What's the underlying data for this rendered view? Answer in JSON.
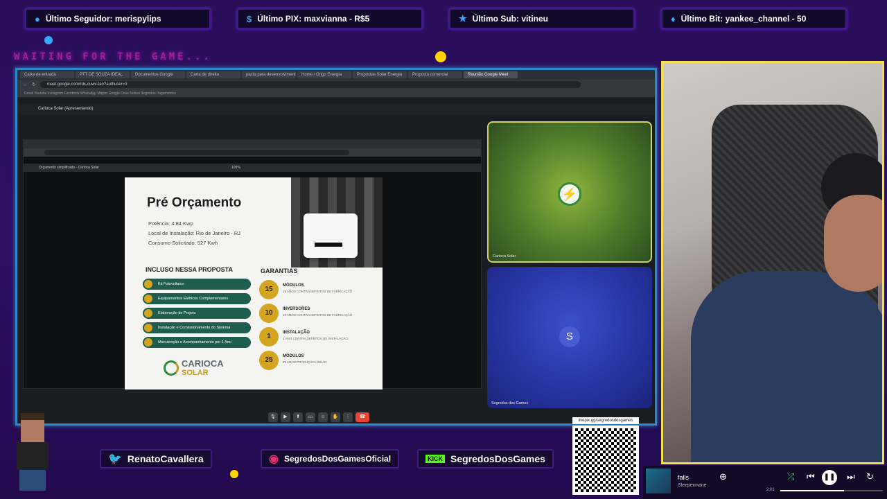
{
  "overlay": {
    "tickers": [
      {
        "label": "Último Seguidor: merispylips",
        "icon": "user-icon"
      },
      {
        "label": "Último PIX: maxvianna - R$5",
        "icon": "dollar-icon"
      },
      {
        "label": "Último Sub: vitineu",
        "icon": "star-icon"
      },
      {
        "label": "Último Bit: yankee_channel - 50",
        "icon": "diamond-icon"
      }
    ],
    "waiting_text": "WAITING FOR THE GAME..."
  },
  "browser": {
    "url": "meet.google.com/rdx-cuwv-tao?authuser=0",
    "tabs": [
      "Caixa de entrada",
      "PTT DE SOUZA IDEAL",
      "Documentos Google",
      "Carta de direito",
      "pasta para desenvolvimento",
      "Home / Origo Energia",
      "Propostas Solar Energia",
      "Proposta comercial",
      "Reunião Google Meet"
    ],
    "bookmarks": "Gmail  Youtube  Instagram  Facebook  WhatsApp  Mapas  Google Drive  Notion  Segredos  Pagamentos"
  },
  "meet": {
    "title": "Carioca Solar (Apresentando)",
    "participants": [
      {
        "name": "Carioca Solar"
      },
      {
        "name": "Segredos dos Games",
        "initial": "S"
      }
    ]
  },
  "shared_screen": {
    "pdf_title_bar": "Orçamento simplificado - Carioca Solar",
    "zoom": "100%",
    "doc": {
      "title": "Pré Orçamento",
      "specs": [
        "Potência: 4.84 Kwp",
        "Local de Instalação: Rio de Janeiro - RJ",
        "Consumo Solicitado: 527 Kwh"
      ],
      "included_title": "INCLUSO NESSA PROPOSTA",
      "included": [
        "Kit Fotovoltaico",
        "Equipamentos Elétricos Complementares",
        "Elaboração de Projeto",
        "Instalação e Comissionamento do Sistema",
        "Manutenção e Acompanhamento por 1 Ano"
      ],
      "guarantees_title": "GARANTIAS",
      "guarantees": [
        {
          "years": "15",
          "item": "MÓDULOS",
          "desc": "15 ANOS CONTRA DEFEITOS DE FABRICAÇÃO"
        },
        {
          "years": "10",
          "item": "INVERSORES",
          "desc": "10 ANOS CONTRA DEFEITOS DE FABRICAÇÃO"
        },
        {
          "years": "1",
          "item": "INSTALAÇÃO",
          "desc": "1 ANO CONTRA DEFEITOS DE INSTALAÇÃO"
        },
        {
          "years": "25",
          "item": "MÓDULOS",
          "desc": "25 ANOS PRODUÇÃO LINEAR"
        }
      ],
      "brand_top": "CARIOCA",
      "brand_bottom": "SOLAR"
    }
  },
  "socials": {
    "twitter": "RenatoCavallera",
    "instagram": "SegredosDosGamesOficial",
    "kick_badge": "KICK",
    "kick": "SegredosDosGames",
    "qr_label": "livepix.gg/segredosdosgames"
  },
  "player": {
    "song": "falls",
    "artist": "Sleepermane",
    "time": "2:01",
    "progress": 0.62
  },
  "colors": {
    "accent": "#2d88c7",
    "cam_border": "#f2e14a",
    "overlay_bg": "#2a0e5a",
    "meet_green": "#1f5d4f"
  }
}
